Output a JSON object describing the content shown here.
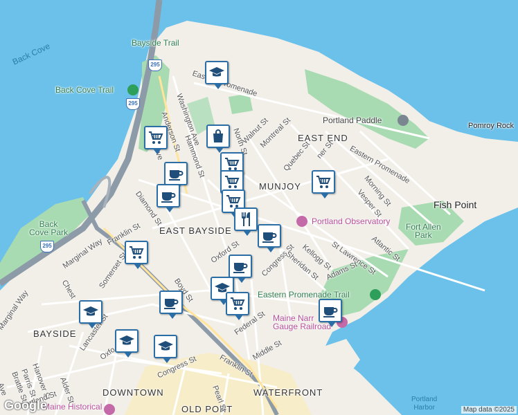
{
  "map": {
    "attribution": "Map data ©2025",
    "provider_logo": "Google",
    "colors": {
      "water": "#6bc1ea",
      "land": "#f2efe9",
      "park": "#a8dbb2",
      "highway": "#8d9aa8",
      "marker_border": "#2b6ea6"
    },
    "water_labels": {
      "back_cove": "Back Cove",
      "portland_harbor": "Portland\nHarbor"
    },
    "area_labels": {
      "east_end": "EAST END",
      "munjoy": "MUNJOY",
      "east_bayside": "EAST BAYSIDE",
      "bayside": "BAYSIDE",
      "downtown": "DOWNTOWN",
      "waterfront": "WATERFRONT",
      "old_port": "OLD PORT"
    },
    "place_labels": {
      "fish_point": "Fish Point",
      "pomroy_rock": "Pomroy Rock",
      "fort_allen_park": "Fort Allen\nPark",
      "back_cove_park": "Back\nCove Park"
    },
    "poi_labels": {
      "bayside_trail": "Bayside Trail",
      "back_cove_trail": "Back Cove Trail",
      "portland_paddle": "Portland Paddle",
      "portland_observatory": "Portland Observatory",
      "eastern_promenade_trail": "Eastern Promenade Trail",
      "maine_narrow_gauge": "Maine Narr\nGauge Railroad",
      "maine_historical": "Maine Historical"
    },
    "highway_shields": [
      "295",
      "295",
      "295"
    ],
    "streets": {
      "eastern_promenade_1": "Eastern Promenade",
      "eastern_promenade_2": "Eastern Promenade",
      "washington_ave": "Washington Ave",
      "anderson_st": "Anderson St",
      "hammond_st": "Hammond St",
      "north_st": "North St",
      "walnut_st": "Walnut St",
      "montreal_st": "Montreal St",
      "quebec_st": "Quebec St",
      "turner_st": "ner St",
      "morning_st": "Morning St",
      "vesper_st": "Vesper St",
      "diamond_st": "Diamond St",
      "oxford_st": "Oxford St",
      "congress_st_1": "Congress St",
      "sheridan_st": "Sheridan St",
      "kellogg_st": "Kellogg St",
      "st_lawrence_st": "St Lawrence St",
      "atlantic_st": "Atlantic St",
      "adams_st": "Adams St",
      "marginal_way_1": "Marginal Way",
      "marginal_way_2": "Marginal Way",
      "franklin_st_1": "Franklin St",
      "franklin_st_2": "Franklin St",
      "somerset_st": "Somerset St",
      "chestnut_st": "Chest",
      "boyd_st": "Boyd St",
      "lancaster_st": "Lancaster St",
      "oxford_st_2": "Oxfo",
      "congress_st_2": "Congress St",
      "federal_st": "Federal St",
      "middle_st": "Middle St",
      "hanover_st": "Hanover St",
      "parris_st": "Parris St",
      "brattle_st": "Brattle St",
      "alder_st": "Alder St",
      "portland_st": "Portland St",
      "pearl_st": "Pearl St",
      "ave": "Ave",
      "ve": "ve"
    },
    "markers": [
      {
        "type": "school",
        "icon": "graduation-cap-icon"
      },
      {
        "type": "shopping",
        "icon": "shopping-bag-icon"
      },
      {
        "type": "grocery",
        "icon": "shopping-cart-icon"
      },
      {
        "type": "grocery",
        "icon": "shopping-cart-icon"
      },
      {
        "type": "cafe",
        "icon": "coffee-cup-icon"
      },
      {
        "type": "cafe",
        "icon": "coffee-cup-icon"
      },
      {
        "type": "grocery",
        "icon": "shopping-cart-icon"
      },
      {
        "type": "grocery",
        "icon": "shopping-cart-icon"
      },
      {
        "type": "restaurant",
        "icon": "fork-knife-icon"
      },
      {
        "type": "cafe",
        "icon": "coffee-cup-icon"
      },
      {
        "type": "grocery",
        "icon": "shopping-cart-icon"
      },
      {
        "type": "cafe",
        "icon": "coffee-cup-icon"
      },
      {
        "type": "school",
        "icon": "graduation-cap-icon"
      },
      {
        "type": "grocery",
        "icon": "shopping-cart-icon"
      },
      {
        "type": "cafe",
        "icon": "coffee-cup-icon"
      },
      {
        "type": "cafe",
        "icon": "coffee-cup-icon"
      },
      {
        "type": "school",
        "icon": "graduation-cap-icon"
      },
      {
        "type": "school",
        "icon": "graduation-cap-icon"
      },
      {
        "type": "school",
        "icon": "graduation-cap-icon"
      }
    ]
  }
}
